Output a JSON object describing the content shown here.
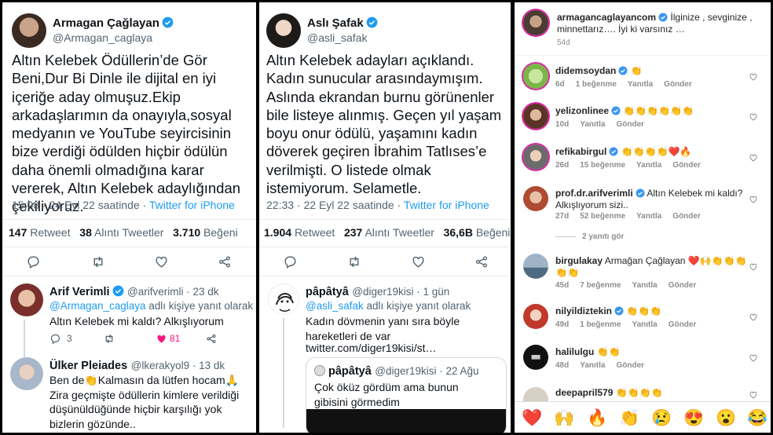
{
  "tweet1": {
    "name": "Armagan Çağlayan",
    "handle": "@Armagan_caglaya",
    "text": "Altın Kelebek Ödüllerin’de Gör Beni,Dur Bi Dinle ile dijital en iyi içeriğe aday olmuşuz.Ekip arkadaşlarımın da onayıyla,sosyal medyanın ve YouTube seyircisinin bize verdiği ödülden hiçbir ödülün daha önemli olmadığına karar vererek, Altın Kelebek adaylığından çekiliyoruz.",
    "time": "15:08 · 24 Eyl 22 saatinde · ",
    "source": "Twitter for iPhone",
    "retweets_count": "147",
    "retweets_label": "Retweet",
    "quotes_count": "38",
    "quotes_label": "Alıntı Tweetler",
    "likes_count": "3.710",
    "likes_label": "Beğeni"
  },
  "tweet1_replies": [
    {
      "name": "Arif Verimli",
      "handle": "@arifverimli · 23 dk",
      "reply_to_handle": "@Armagan_caglaya",
      "reply_to_suffix": " adlı kişiye yanıt olarak",
      "text": "Altın Kelebek mi kaldı? Alkışlıyorum",
      "reply_count": "3",
      "like_count": "81"
    },
    {
      "name": "Ülker Pleiades",
      "handle": "@lkerakyol9 · 13 dk",
      "text": "Ben de👏Kalmasın da lütfen hocam🙏Zira geçmişte ödüllerin kimlere verildiği düşünüldüğünde hiçbir karşılığı yok bizlerin gözünde.."
    }
  ],
  "tweet2": {
    "name": "Aslı Şafak",
    "handle": "@asli_safak",
    "text": "Altın Kelebek adayları açıklandı. Kadın sunucular arasındaymışım. Aslında ekrandan burnu görünenler bile listeye alınmış. Geçen yıl yaşam boyu onur ödülü, yaşamını kadın döverek geçiren İbrahim Tatlıses’e verilmişti. O listede olmak istemiyorum. Selametle.",
    "time": "22:33 · 22 Eyl 22 saatinde · ",
    "source": "Twitter for iPhone",
    "retweets_count": "1.904",
    "retweets_label": "Retweet",
    "quotes_count": "237",
    "quotes_label": "Alıntı Tweetler",
    "likes_count": "36,6B",
    "likes_label": "Beğeni"
  },
  "tweet2_reply": {
    "name": "pâpâtyâ",
    "handle": "@diger19kisi · 1 gün",
    "reply_to_handle": "@asli_safak",
    "reply_to_suffix": " adlı kişiye yanıt olarak",
    "text": "Kadın dövmenin yanı sıra böyle hareketleri de var",
    "link": "twitter.com/diger19kisi/st…",
    "quoted": {
      "name": "pâpâtyâ",
      "handle": "@diger19kisi · 22 Ağu",
      "text": "Çok öküz gördüm ama bunun gibisini görmedim"
    }
  },
  "instagram": {
    "post": {
      "username": "armagancaglayancom",
      "text": "İlginize , sevginize , minnettarız…. İyi ki varsınız …",
      "time": "54d"
    },
    "comments": [
      {
        "username": "didemsoydan",
        "verified": true,
        "text": "👏",
        "time": "6d",
        "likes": "1 beğenme",
        "reply": "Yanıtla",
        "send": "Gönder"
      },
      {
        "username": "yelizonlinee",
        "verified": true,
        "text": "👏👏👏👏👏👏",
        "time": "10d",
        "likes": "",
        "reply": "Yanıtla",
        "send": "Gönder"
      },
      {
        "username": "refikabirgul",
        "verified": true,
        "text": "👏👏👏👏❤️🔥",
        "time": "26d",
        "likes": "15 beğenme",
        "reply": "Yanıtla",
        "send": "Gönder"
      },
      {
        "username": "prof.dr.arifverimli",
        "verified": true,
        "text": "Altın Kelebek mi kaldı? Alkışlıyorum sizi..",
        "time": "27d",
        "likes": "52 beğenme",
        "reply": "Yanıtla",
        "send": "Gönder",
        "replies": "2 yanıtı gör"
      },
      {
        "username": "birgulakay",
        "verified": false,
        "text": "Armağan Çağlayan ❤️🙌👏👏👏👏👏",
        "time": "45d",
        "likes": "7 beğenme",
        "reply": "Yanıtla",
        "send": "Gönder"
      },
      {
        "username": "nilyildiztekin",
        "verified": true,
        "text": "👏👏👏",
        "time": "49d",
        "likes": "1 beğenme",
        "reply": "Yanıtla",
        "send": "Gönder"
      },
      {
        "username": "halilulgu",
        "verified": false,
        "text": "👏👏",
        "time": "48d",
        "likes": "",
        "reply": "Yanıtla",
        "send": "Gönder"
      },
      {
        "username": "deepapril579",
        "verified": false,
        "text": "👏👏👏👏",
        "time": "",
        "likes": "",
        "reply": "",
        "send": ""
      }
    ],
    "emoji_bar": [
      "❤️",
      "🙌",
      "🔥",
      "👏",
      "😢",
      "😍",
      "😮",
      "😂"
    ]
  },
  "colors": {
    "twitter_blue": "#1d9bf0",
    "like_pink": "#f91880",
    "secondary": "#536471"
  },
  "icons": [
    "verified-badge-icon",
    "reply-icon",
    "retweet-icon",
    "like-icon",
    "share-icon",
    "heart-outline-icon"
  ]
}
